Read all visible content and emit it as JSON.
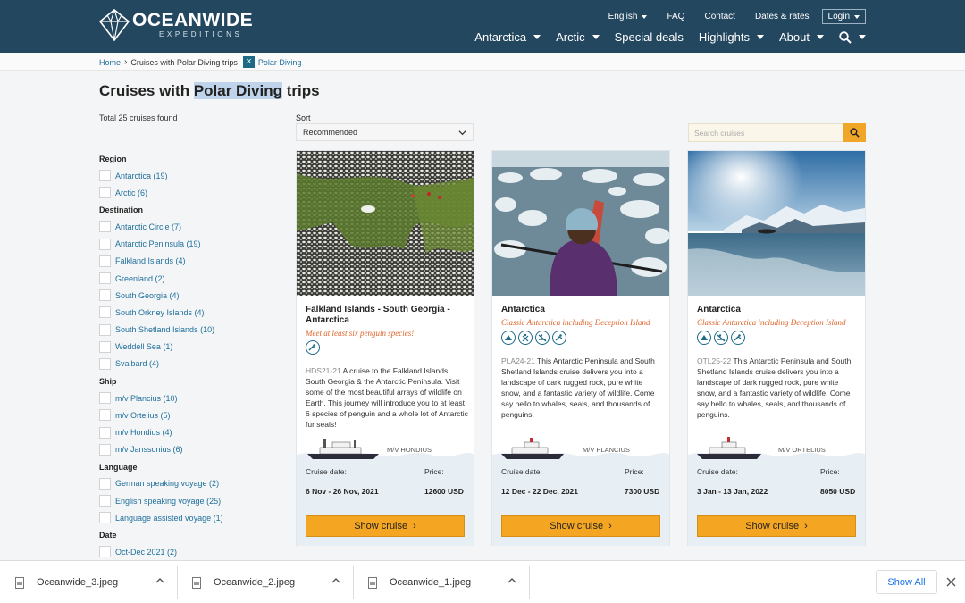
{
  "header": {
    "logo_main": "OCEANWIDE",
    "logo_sub": "EXPEDITIONS",
    "utility": {
      "language": "English",
      "faq": "FAQ",
      "contact": "Contact",
      "dates": "Dates & rates",
      "login": "Login"
    },
    "nav": [
      {
        "label": "Antarctica",
        "dropdown": true
      },
      {
        "label": "Arctic",
        "dropdown": true
      },
      {
        "label": "Special deals",
        "dropdown": false
      },
      {
        "label": "Highlights",
        "dropdown": true
      },
      {
        "label": "About",
        "dropdown": true
      }
    ],
    "search_icon": "search-icon"
  },
  "breadcrumb": {
    "home": "Home",
    "current": "Cruises with Polar Diving trips",
    "filter": "Polar Diving",
    "separator": "›"
  },
  "page": {
    "title_pre": "Cruises with ",
    "title_hl": "Polar Diving",
    "title_post": " trips",
    "total": "Total 25 cruises found"
  },
  "sort": {
    "label": "Sort",
    "value": "Recommended"
  },
  "search": {
    "placeholder": "Search cruises"
  },
  "filters": [
    {
      "title": "Region",
      "items": [
        "Antarctica (19)",
        "Arctic (6)"
      ]
    },
    {
      "title": "Destination",
      "items": [
        "Antarctic Circle (7)",
        "Antarctic Peninsula (19)",
        "Falkland Islands (4)",
        "Greenland (2)",
        "South Georgia (4)",
        "South Orkney Islands (4)",
        "South Shetland Islands (10)",
        "Weddell Sea (1)",
        "Svalbard (4)"
      ]
    },
    {
      "title": "Ship",
      "items": [
        "m/v Plancius (10)",
        "m/v Ortelius (5)",
        "m/v Hondius (4)",
        "m/v Janssonius (6)"
      ]
    },
    {
      "title": "Language",
      "items": [
        "German speaking voyage (2)",
        "English speaking voyage (25)",
        "Language assisted voyage (1)"
      ]
    },
    {
      "title": "Date",
      "items": [
        "Oct-Dec 2021 (2)"
      ]
    }
  ],
  "cards": [
    {
      "title": "Falkland Islands - South Georgia - Antarctica",
      "subtitle": "Meet at least six penguin species!",
      "code": "HDS21-21",
      "description": " A cruise to the Falkland Islands, South Georgia & the Antarctic Peninsula. Visit some of the most beautiful arrays of wildlife on Earth. This journey will introduce you to at least 6 species of penguin and a whole lot of Antarctic fur seals!",
      "icons": [
        "diving-icon"
      ],
      "ship": "M/V HONDIUS",
      "date_label": "Cruise date:",
      "date": "6 Nov - 26 Nov, 2021",
      "price_label": "Price:",
      "price": "12600 USD",
      "button": "Show cruise"
    },
    {
      "title": "Antarctica",
      "subtitle": "Classic Antarctica including Deception Island",
      "code": "PLA24-21",
      "description": " This Antarctic Peninsula and South Shetland Islands cruise delivers you into a landscape of dark rugged rock, pure white snow, and a fantastic variety of wildlife. Come say hello to whales, seals, and thousands of penguins.",
      "icons": [
        "camping-icon",
        "snowshoe-icon",
        "kayak-icon",
        "diving-icon"
      ],
      "ship": "M/V PLANCIUS",
      "date_label": "Cruise date:",
      "date": "12 Dec - 22 Dec, 2021",
      "price_label": "Price:",
      "price": "7300 USD",
      "button": "Show cruise"
    },
    {
      "title": "Antarctica",
      "subtitle": "Classic Antarctica including Deception Island",
      "code": "OTL25-22",
      "description": " This Antarctic Peninsula and South Shetland Islands cruise delivers you into a landscape of dark rugged rock, pure white snow, and a fantastic variety of wildlife. Come say hello to whales, seals, and thousands of penguins.",
      "icons": [
        "camping-icon",
        "kayak-icon",
        "diving-icon"
      ],
      "ship": "M/V ORTELIUS",
      "date_label": "Cruise date:",
      "date": "3 Jan - 13 Jan, 2022",
      "price_label": "Price:",
      "price": "8050 USD",
      "button": "Show cruise"
    }
  ],
  "downloads": {
    "files": [
      "Oceanwide_3.jpeg",
      "Oceanwide_2.jpeg",
      "Oceanwide_1.jpeg"
    ],
    "show_all": "Show All"
  },
  "colors": {
    "header_bg": "#244760",
    "accent": "#f4a521",
    "link": "#1f6f9c",
    "subtitle": "#e0642a",
    "icon": "#1c6a86"
  }
}
